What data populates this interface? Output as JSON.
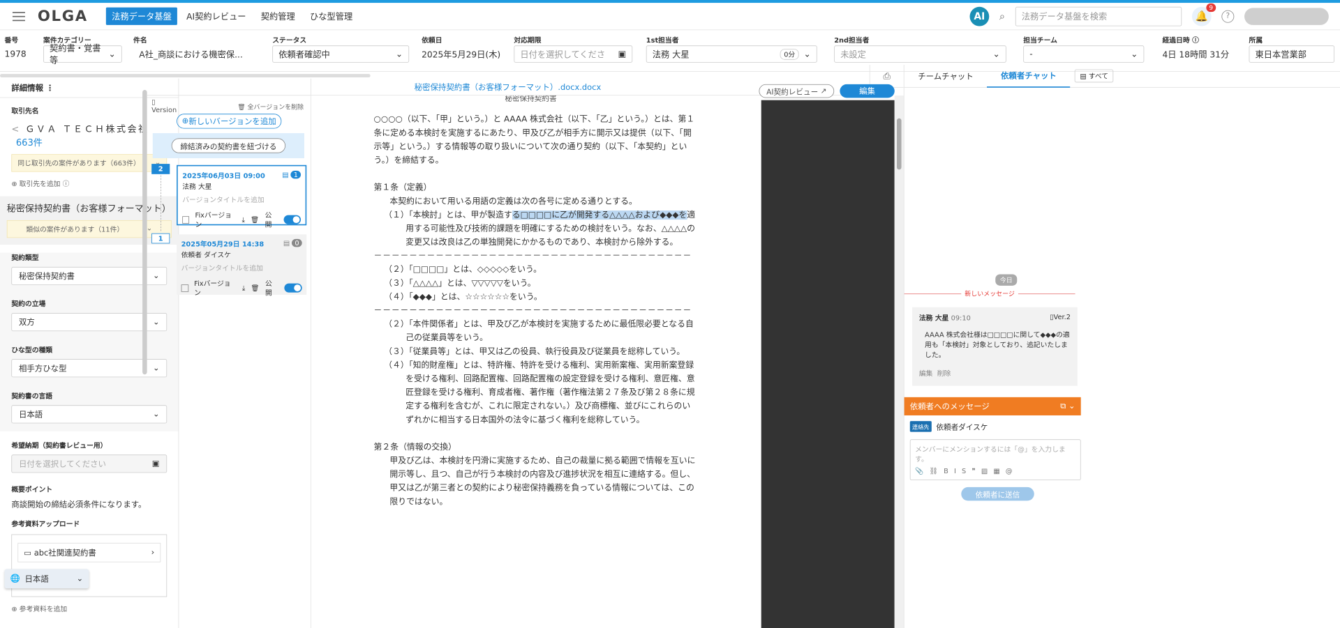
{
  "header": {
    "logo": "OLGA",
    "nav": [
      "法務データ基盤",
      "AI契約レビュー",
      "契約管理",
      "ひな型管理"
    ],
    "ai_label": "AI",
    "search_placeholder": "法務データ基盤を検索",
    "notif_count": "9",
    "help": "?"
  },
  "infobar": {
    "number": {
      "label": "番号",
      "value": "1978"
    },
    "category": {
      "label": "案件カテゴリー",
      "value": "契約書・覚書等"
    },
    "title": {
      "label": "件名",
      "value": "A社_商談における機密保..."
    },
    "status": {
      "label": "ステータス",
      "value": "依頼者確認中"
    },
    "request_date": {
      "label": "依頼日",
      "value": "2025年5月29日(木)"
    },
    "deadline": {
      "label": "対応期限",
      "placeholder": "日付を選択してくださ"
    },
    "first": {
      "label": "1st担当者",
      "value": "法務 大星",
      "badge": "0分"
    },
    "second": {
      "label": "2nd担当者",
      "placeholder": "未設定"
    },
    "team": {
      "label": "担当チーム",
      "value": "-"
    },
    "elapsed": {
      "label": "経過日時",
      "value": "4日 18時間 31分"
    },
    "dept": {
      "label": "所属",
      "value": "東日本営業部"
    }
  },
  "left": {
    "title": "詳細情報",
    "partner_label": "取引先名",
    "partner": "ＧＶＡ ＴＥＣＨ株式会社",
    "partner_count": "663件",
    "partner_notice": "同じ取引先の案件があります（663件）",
    "add_partner": "取引先を追加",
    "doc_title": "秘密保持契約書（お客様フォーマット）...",
    "doc_notice": "類似の案件があります（11件）",
    "contract_type_label": "契約類型",
    "contract_type": "秘密保持契約書",
    "position_label": "契約の立場",
    "position": "双方",
    "template_label": "ひな型の種類",
    "template": "相手方ひな型",
    "language_label": "契約書の言語",
    "language": "日本語",
    "due_label": "希望納期（契約書レビュー用）",
    "due_placeholder": "日付を選択してください",
    "summary_label": "概要ポイント",
    "summary": "商談開始の締結必須条件になります。",
    "upload_label": "参考資料アップロード",
    "folder": "abc社関連契約書",
    "add_ref": "参考資料を追加",
    "lang_switch": "日本語"
  },
  "versions": {
    "doc_tab": "秘密保持契約書（お客様フォーマット）.docx.docx",
    "version_label": "Version",
    "delete_all": "全バージョンを削除",
    "add_version": "新しいバージョンを追加",
    "link_contract": "締結済みの契約書を紐づける",
    "items": [
      {
        "num": "2",
        "date": "2025年06月03日 09:00",
        "name": "法務 大星",
        "title_placeholder": "バージョンタイトルを追加",
        "fix": "Fixバージョン",
        "public": "公開",
        "comments": "1"
      },
      {
        "num": "1",
        "date": "2025年05月29日 14:38",
        "name": "依頼者 ダイスケ",
        "title_placeholder": "バージョンタイトルを追加",
        "fix": "Fixバージョン",
        "public": "公開",
        "comments": "0"
      }
    ]
  },
  "document": {
    "ai_review": "AI契約レビュー",
    "edit": "編集",
    "top_cut": "秘密保持契約書",
    "intro": "○○○○（以下、「甲」という。）と AAAA 株式会社（以下、「乙」という。）とは、第１条に定める本検討を実施するにあたり、甲及び乙が相手方に開示又は提供（以下、「開示等」という。）する情報等の取り扱いについて次の通り契約（以下、「本契約」という。）を締結する。",
    "art1": "第１条（定義）",
    "art1_lead": "本契約において用いる用語の定義は次の各号に定める通りとする。",
    "item1_a": "（１）「本検討」とは、甲が製造す",
    "item1_hl": "る□□□□に乙が開発する△△△△および◆◆◆を",
    "item1_b": "適用する可能性及び技術的課題を明確にするための検討をいう。なお、△△△△の変更又は改良は乙の単独開発にかかるものであり、本検討から除外する。",
    "dash1": "－－－－－－－－－－－－－－－－－－－－－－－－－－－－－－－－－－－－",
    "item2a": "（２）「□□□□」とは、◇◇◇◇◇をいう。",
    "item3a": "（３）「△△△△」とは、▽▽▽▽▽をいう。",
    "item4a": "（４）「◆◆◆」とは、☆☆☆☆☆☆をいう。",
    "dash2": "－－－－－－－－－－－－－－－－－－－－－－－－－－－－－－－－－－－－",
    "item2b": "（２）「本件関係者」とは、甲及び乙が本検討を実施するために最低限必要となる自己の従業員等をいう。",
    "item3b": "（３）「従業員等」とは、甲又は乙の役員、執行役員及び従業員を総称していう。",
    "item4b": "（４）「知的財産権」とは、特許権、特許を受ける権利、実用新案権、実用新案登録を受ける権利、回路配置権、回路配置権の設定登録を受ける権利、意匠権、意匠登録を受ける権利、育成者権、著作権（著作権法第２７条及び第２８条に規定する権利を含むが、これに限定されない。）及び商標権、並びにこれらのいずれかに相当する日本国外の法令に基づく権利を総称していう。",
    "art2": "第２条（情報の交換）",
    "art2_body": "甲及び乙は、本検討を円滑に実施するため、自己の裁量に拠る範囲で情報を互いに開示等し、且つ、自己が行う本検討の内容及び進捗状況を相互に連絡する。但し、甲又は乙が第三者との契約により秘密保持義務を負っている情報については、この限りではない。"
  },
  "chat": {
    "tab_team": "チームチャット",
    "tab_requester": "依頼者チャット",
    "all": "すべて",
    "today": "今日",
    "new_message": "新しいメッセージ",
    "msg": {
      "author": "法務 大星",
      "time": "09:10",
      "ver": "Ver.2",
      "body": "AAAA 株式会社様は□□□□に関して◆◆◆の適用も「本検討」対象としており、追記いたしました。",
      "edit": "編集",
      "delete": "削除"
    },
    "to_requester": "依頼者へのメッセージ",
    "contact_tag": "連絡先",
    "contact_name": "依頼者ダイスケ",
    "input_placeholder": "メンバーにメンションするには「@」を入力します。",
    "send": "依頼者に送信"
  }
}
